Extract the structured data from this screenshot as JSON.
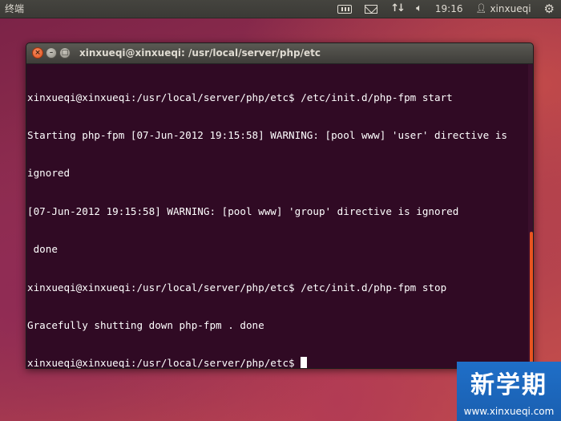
{
  "panel": {
    "app_title": "终端",
    "clock": "19:16",
    "username": "xinxueqi",
    "icons": [
      "keyboard-icon",
      "mail-icon",
      "network-icon",
      "volume-icon",
      "user-icon",
      "gear-icon"
    ]
  },
  "window": {
    "title": "xinxueqi@xinxueqi: /usr/local/server/php/etc",
    "buttons": {
      "close": "×",
      "minimize": "–",
      "maximize": "□"
    }
  },
  "terminal": {
    "lines": [
      "xinxueqi@xinxueqi:/usr/local/server/php/etc$ /etc/init.d/php-fpm start",
      "Starting php-fpm [07-Jun-2012 19:15:58] WARNING: [pool www] 'user' directive is",
      "ignored",
      "[07-Jun-2012 19:15:58] WARNING: [pool www] 'group' directive is ignored",
      " done",
      "xinxueqi@xinxueqi:/usr/local/server/php/etc$ /etc/init.d/php-fpm stop",
      "Gracefully shutting down php-fpm . done"
    ],
    "prompt": "xinxueqi@xinxueqi:/usr/local/server/php/etc$ "
  },
  "watermark": {
    "text": "新学期",
    "url": "www.xinxueqi.com"
  },
  "colors": {
    "terminal_bg": "#300a24",
    "accent": "#e95420",
    "panel_bg": "#3c3b37"
  }
}
